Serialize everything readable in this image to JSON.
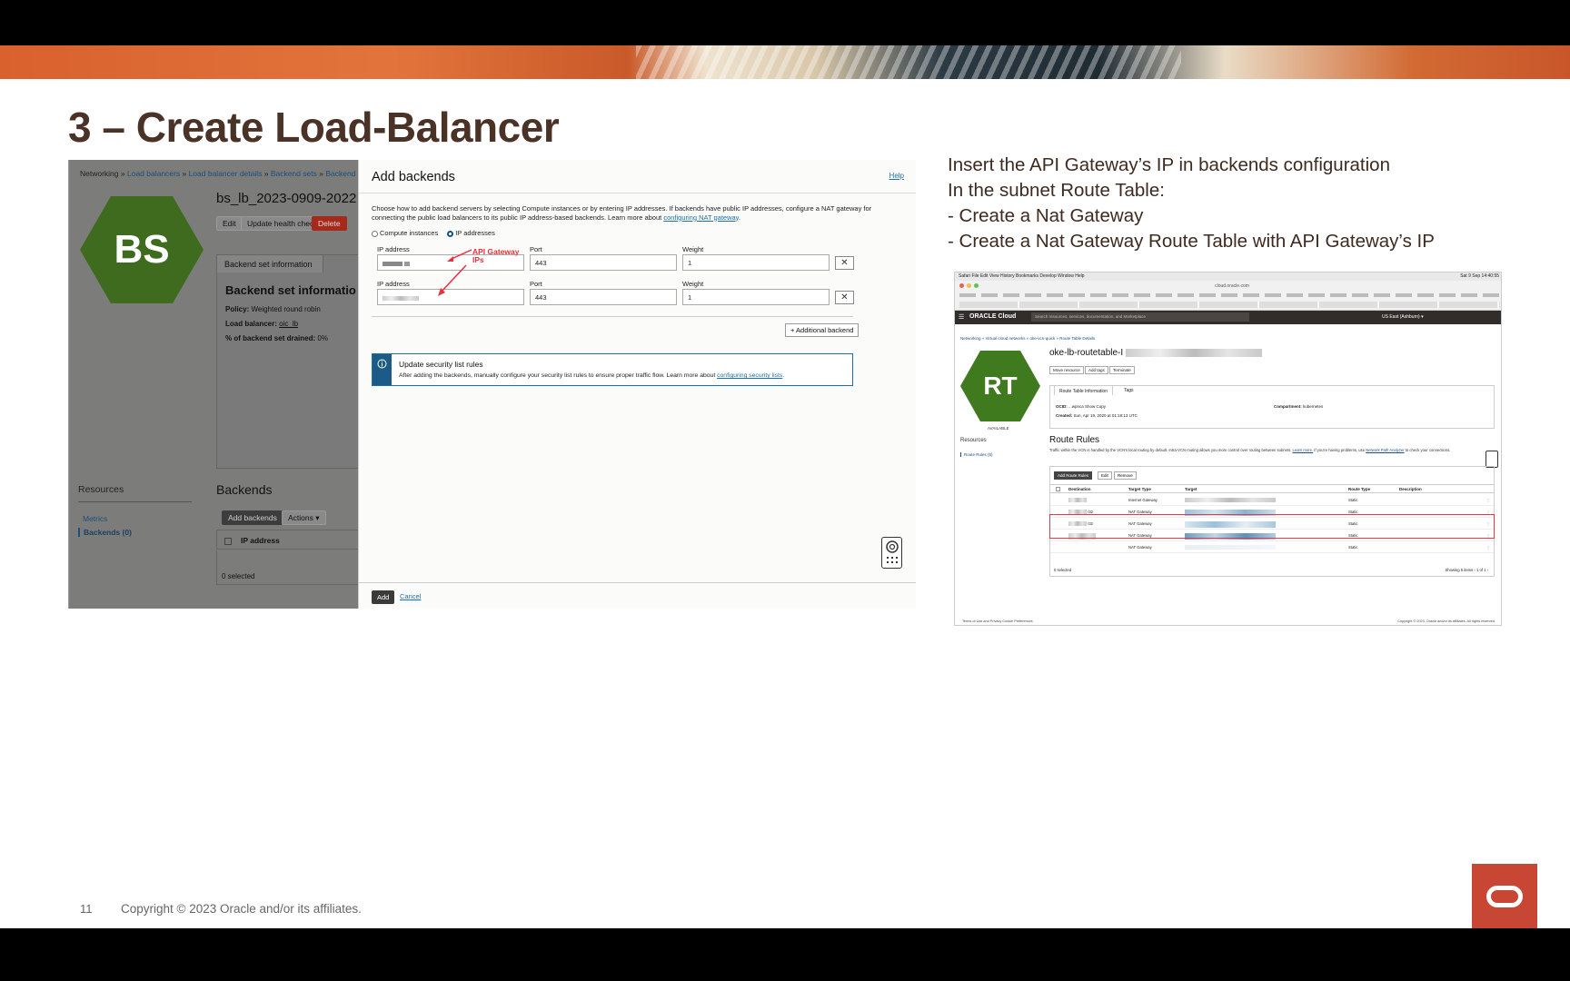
{
  "slide": {
    "title": "3 – Create Load-Balancer",
    "notes": [
      "Insert the API Gateway’s IP in backends configuration",
      "In the subnet Route Table:",
      "- Create a Nat Gateway",
      "- Create a Nat Gateway Route Table with API Gateway’s IP"
    ],
    "page_number": "11",
    "copyright": "Copyright © 2023 Oracle and/or its affiliates.",
    "brand_color": "#c74634",
    "title_color": "#4a3227"
  },
  "lb_screen": {
    "breadcrumbs": [
      "Networking",
      "Load balancers",
      "Load balancer details",
      "Backend sets",
      "Backend set details"
    ],
    "hex_label": "BS",
    "name": "bs_lb_2023-0909-2022",
    "buttons": {
      "edit": "Edit",
      "update_health": "Update health check",
      "delete": "Delete"
    },
    "tab": "Backend set information",
    "section_title": "Backend set informatio",
    "policy_label": "Policy:",
    "policy_value": "Weighted round robin",
    "lb_label": "Load balancer:",
    "lb_value": "oic_lb",
    "drained_label": "% of backend set drained:",
    "drained_value": "0%",
    "resources_title": "Resources",
    "resources_items": [
      "Metrics",
      "Backends (0)"
    ],
    "backends_title": "Backends",
    "add_backends": "Add backends",
    "actions": "Actions",
    "col_ip": "IP address",
    "selected": "0 selected"
  },
  "add_panel": {
    "title": "Add backends",
    "help": "Help",
    "description": "Choose how to add backend servers by selecting Compute instances or by entering IP addresses. If backends have public IP addresses, configure a NAT gateway for connecting the public load balancers to its public IP address-based backends. Learn more about",
    "description_link": "configuring NAT gateway",
    "radio_compute": "Compute instances",
    "radio_ip": "IP addresses",
    "rows": [
      {
        "ip_label": "IP address",
        "port_label": "Port",
        "port": "443",
        "weight_label": "Weight",
        "weight": "1"
      },
      {
        "ip_label": "IP address",
        "port_label": "Port",
        "port": "443",
        "weight_label": "Weight",
        "weight": "1"
      }
    ],
    "annotation": "API Gateway IPs",
    "additional": "+ Additional backend",
    "info_title": "Update security list rules",
    "info_body": "After adding the backends, manually configure your security list rules to ensure proper traffic flow. Learn more about",
    "info_link": "configuring security lists",
    "add": "Add",
    "cancel": "Cancel",
    "annotation_color": "#e8323e"
  },
  "rt_screen": {
    "mac_menu": "Safari  File  Edit  View  History  Bookmarks  Develop  Window  Help",
    "mac_time": "Sat 9 Sep  14:40:55",
    "url": "cloud.oracle.com",
    "brand": "ORACLE Cloud",
    "search_placeholder": "Search resources, services, documentation, and Marketplace",
    "region": "US East (Ashburn)",
    "breadcrumbs": "Networking » Virtual cloud networks » oke-vcn-quick » Route Table Details",
    "hex_label": "RT",
    "status": "AVAILABLE",
    "name": "oke-lb-routetable-I",
    "buttons": [
      "Move resource",
      "Add tags",
      "Terminate"
    ],
    "tabs": [
      "Route Table Information",
      "Tags"
    ],
    "ocid_label": "OCID:",
    "ocid_value": "...wpnca  Show  Copy",
    "created_label": "Created:",
    "created_value": "Sun, Apr 19, 2020 at 01:18:13 UTC",
    "compartment_label": "Compartment:",
    "compartment_value": "kubernetes",
    "resources": "Resources",
    "route_rules_link": "Route Rules (5)",
    "route_rules_title": "Route Rules",
    "route_rules_desc": "Traffic within the VCN is handled by the VCN's local routing by default. Intra-VCN routing allows you more control over routing between subnets.",
    "learn_more": "Learn more.",
    "desc_tail": "If you're having problems, use",
    "npa_link": "Network Path Analyzer",
    "desc_end": "to check your connections.",
    "tools": [
      "Add Route Rules",
      "Edit",
      "Remove"
    ],
    "columns": [
      "Destination",
      "Target Type",
      "Target",
      "Route Type",
      "Description"
    ],
    "rows": [
      {
        "dest": "",
        "type": "Internet Gateway",
        "route": "Static"
      },
      {
        "dest": "/32",
        "type": "NAT Gateway",
        "route": "Static"
      },
      {
        "dest": "/32",
        "type": "NAT Gateway",
        "route": "Static"
      },
      {
        "dest": "",
        "type": "NAT Gateway",
        "route": "Static"
      },
      {
        "dest": "",
        "type": "NAT Gateway",
        "route": "Static"
      }
    ],
    "selected": "0 selected",
    "showing": "Showing 5 items  ‹  1 of 1  ›",
    "footer_left": "Terms of Use and Privacy    Cookie Preferences",
    "footer_right": "Copyright © 2023, Oracle and/or its affiliates. All rights reserved.",
    "highlight_color": "#e23b4a"
  }
}
